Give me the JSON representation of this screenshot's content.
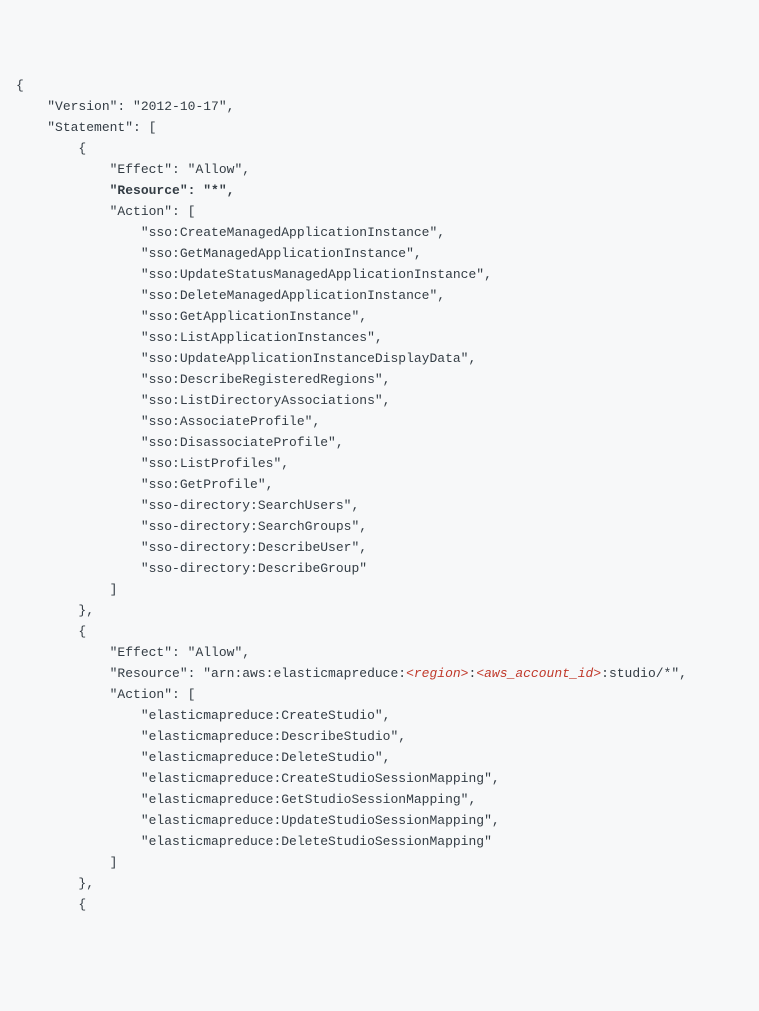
{
  "lines": [
    {
      "indent": 0,
      "tokens": [
        {
          "t": "{"
        }
      ]
    },
    {
      "indent": 1,
      "tokens": [
        {
          "t": "\"Version\": \"2012-10-17\","
        }
      ]
    },
    {
      "indent": 1,
      "tokens": [
        {
          "t": "\"Statement\": ["
        }
      ]
    },
    {
      "indent": 2,
      "tokens": [
        {
          "t": "{"
        }
      ]
    },
    {
      "indent": 3,
      "tokens": [
        {
          "t": "\"Effect\": \"Allow\","
        }
      ]
    },
    {
      "indent": 3,
      "tokens": [
        {
          "t": "\"Resource\": \"*\",",
          "bold": true
        }
      ]
    },
    {
      "indent": 3,
      "tokens": [
        {
          "t": "\"Action\": ["
        }
      ]
    },
    {
      "indent": 4,
      "tokens": [
        {
          "t": "\"sso:CreateManagedApplicationInstance\","
        }
      ]
    },
    {
      "indent": 4,
      "tokens": [
        {
          "t": "\"sso:GetManagedApplicationInstance\","
        }
      ]
    },
    {
      "indent": 4,
      "tokens": [
        {
          "t": "\"sso:UpdateStatusManagedApplicationInstance\","
        }
      ]
    },
    {
      "indent": 4,
      "tokens": [
        {
          "t": "\"sso:DeleteManagedApplicationInstance\","
        }
      ]
    },
    {
      "indent": 4,
      "tokens": [
        {
          "t": "\"sso:GetApplicationInstance\","
        }
      ]
    },
    {
      "indent": 4,
      "tokens": [
        {
          "t": "\"sso:ListApplicationInstances\","
        }
      ]
    },
    {
      "indent": 4,
      "tokens": [
        {
          "t": "\"sso:UpdateApplicationInstanceDisplayData\","
        }
      ]
    },
    {
      "indent": 4,
      "tokens": [
        {
          "t": "\"sso:DescribeRegisteredRegions\","
        }
      ]
    },
    {
      "indent": 4,
      "tokens": [
        {
          "t": "\"sso:ListDirectoryAssociations\","
        }
      ]
    },
    {
      "indent": 4,
      "tokens": [
        {
          "t": "\"sso:AssociateProfile\","
        }
      ]
    },
    {
      "indent": 4,
      "tokens": [
        {
          "t": "\"sso:DisassociateProfile\","
        }
      ]
    },
    {
      "indent": 4,
      "tokens": [
        {
          "t": "\"sso:ListProfiles\","
        }
      ]
    },
    {
      "indent": 4,
      "tokens": [
        {
          "t": "\"sso:GetProfile\","
        }
      ]
    },
    {
      "indent": 4,
      "tokens": [
        {
          "t": "\"sso-directory:SearchUsers\","
        }
      ]
    },
    {
      "indent": 4,
      "tokens": [
        {
          "t": "\"sso-directory:SearchGroups\","
        }
      ]
    },
    {
      "indent": 4,
      "tokens": [
        {
          "t": "\"sso-directory:DescribeUser\","
        }
      ]
    },
    {
      "indent": 4,
      "tokens": [
        {
          "t": "\"sso-directory:DescribeGroup\""
        }
      ]
    },
    {
      "indent": 3,
      "tokens": [
        {
          "t": "]"
        }
      ]
    },
    {
      "indent": 2,
      "tokens": [
        {
          "t": "},"
        }
      ]
    },
    {
      "indent": 2,
      "tokens": [
        {
          "t": "{"
        }
      ]
    },
    {
      "indent": 3,
      "tokens": [
        {
          "t": "\"Effect\": \"Allow\","
        }
      ]
    },
    {
      "indent": 3,
      "tokens": [
        {
          "t": "\"Resource\": \"arn:aws:elasticmapreduce:"
        },
        {
          "t": "<region>",
          "repl": true
        },
        {
          "t": ":"
        },
        {
          "t": "<aws_account_id>",
          "repl": true
        },
        {
          "t": ":studio/*\","
        }
      ]
    },
    {
      "indent": 3,
      "tokens": [
        {
          "t": "\"Action\": ["
        }
      ]
    },
    {
      "indent": 4,
      "tokens": [
        {
          "t": "\"elasticmapreduce:CreateStudio\","
        }
      ]
    },
    {
      "indent": 4,
      "tokens": [
        {
          "t": "\"elasticmapreduce:DescribeStudio\","
        }
      ]
    },
    {
      "indent": 4,
      "tokens": [
        {
          "t": "\"elasticmapreduce:DeleteStudio\","
        }
      ]
    },
    {
      "indent": 4,
      "tokens": [
        {
          "t": "\"elasticmapreduce:CreateStudioSessionMapping\","
        }
      ]
    },
    {
      "indent": 4,
      "tokens": [
        {
          "t": "\"elasticmapreduce:GetStudioSessionMapping\","
        }
      ]
    },
    {
      "indent": 4,
      "tokens": [
        {
          "t": "\"elasticmapreduce:UpdateStudioSessionMapping\","
        }
      ]
    },
    {
      "indent": 4,
      "tokens": [
        {
          "t": "\"elasticmapreduce:DeleteStudioSessionMapping\""
        }
      ]
    },
    {
      "indent": 3,
      "tokens": [
        {
          "t": "]"
        }
      ]
    },
    {
      "indent": 2,
      "tokens": [
        {
          "t": "},"
        }
      ]
    },
    {
      "indent": 2,
      "tokens": [
        {
          "t": "{"
        }
      ]
    }
  ]
}
